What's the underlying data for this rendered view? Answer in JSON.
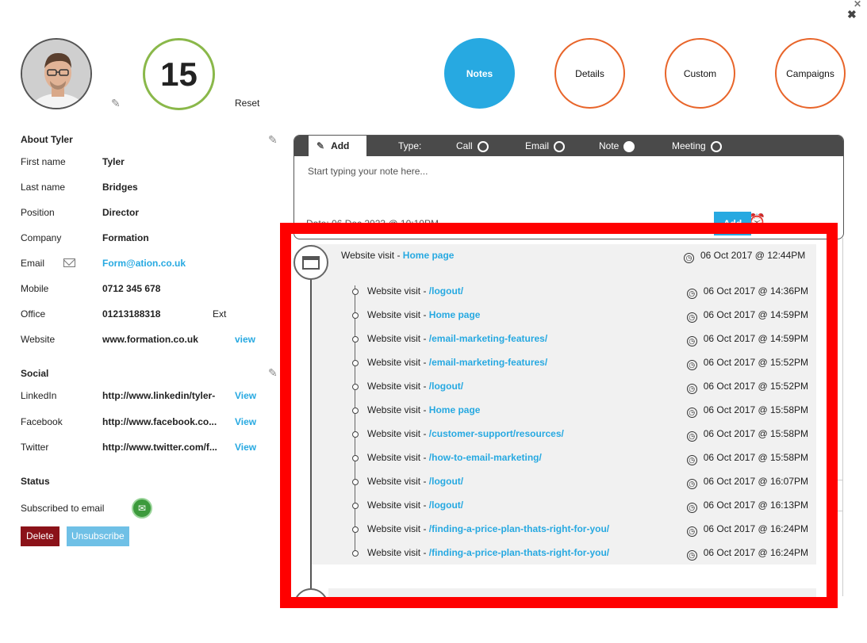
{
  "profile": {
    "score": "15",
    "reset_label": "Reset"
  },
  "tabs": [
    {
      "label": "Notes",
      "active": true
    },
    {
      "label": "Details",
      "active": false
    },
    {
      "label": "Custom",
      "active": false
    },
    {
      "label": "Campaigns",
      "active": false
    }
  ],
  "about": {
    "title": "About Tyler",
    "first_name_label": "First name",
    "first_name": "Tyler",
    "last_name_label": "Last name",
    "last_name": "Bridges",
    "position_label": "Position",
    "position": "Director",
    "company_label": "Company",
    "company": "Formation",
    "email_label": "Email",
    "email": "Form@ation.co.uk",
    "mobile_label": "Mobile",
    "mobile": "0712 345 678",
    "office_label": "Office",
    "office": "01213188318",
    "ext_label": "Ext",
    "website_label": "Website",
    "website": "www.formation.co.uk",
    "website_link": "view"
  },
  "social": {
    "title": "Social",
    "linkedin_label": "LinkedIn",
    "linkedin": "http://www.linkedin/tyler-",
    "linkedin_link": "View",
    "facebook_label": "Facebook",
    "facebook": "http://www.facebook.co...",
    "facebook_link": "View",
    "twitter_label": "Twitter",
    "twitter": "http://www.twitter.com/f...",
    "twitter_link": "View"
  },
  "status": {
    "title": "Status",
    "subscribed_label": "Subscribed to email",
    "delete_label": "Delete",
    "unsubscribe_label": "Unsubscribe"
  },
  "note": {
    "add_tab": "Add",
    "type_label": "Type:",
    "types": [
      "Call",
      "Email",
      "Note",
      "Meeting"
    ],
    "selected_type": "Note",
    "placeholder": "Start typing your note here...",
    "date_text": "Date: 06 Dec 2023 @ 10:10PM",
    "add_button": "Add"
  },
  "timeline": {
    "header_prefix": "Website visit - ",
    "header_page": "Home page",
    "header_time": "06 Oct 2017 @ 12:44PM",
    "visits": [
      {
        "prefix": "Website visit - ",
        "page": "/logout/",
        "time": "06 Oct 2017 @ 14:36PM"
      },
      {
        "prefix": "Website visit - ",
        "page": "Home page",
        "time": "06 Oct 2017 @ 14:59PM"
      },
      {
        "prefix": "Website visit - ",
        "page": "/email-marketing-features/",
        "time": "06 Oct 2017 @ 14:59PM"
      },
      {
        "prefix": "Website visit - ",
        "page": "/email-marketing-features/",
        "time": "06 Oct 2017 @ 15:52PM"
      },
      {
        "prefix": "Website visit - ",
        "page": "/logout/",
        "time": "06 Oct 2017 @ 15:52PM"
      },
      {
        "prefix": "Website visit - ",
        "page": "Home page",
        "time": "06 Oct 2017 @ 15:58PM"
      },
      {
        "prefix": "Website visit - ",
        "page": "/customer-support/resources/",
        "time": "06 Oct 2017 @ 15:58PM"
      },
      {
        "prefix": "Website visit - ",
        "page": "/how-to-email-marketing/",
        "time": "06 Oct 2017 @ 15:58PM"
      },
      {
        "prefix": "Website visit - ",
        "page": "/logout/",
        "time": "06 Oct 2017 @ 16:07PM"
      },
      {
        "prefix": "Website visit - ",
        "page": "/logout/",
        "time": "06 Oct 2017 @ 16:13PM"
      },
      {
        "prefix": "Website visit - ",
        "page": "/finding-a-price-plan-thats-right-for-you/",
        "time": "06 Oct 2017 @ 16:24PM"
      },
      {
        "prefix": "Website visit - ",
        "page": "/finding-a-price-plan-thats-right-for-you/",
        "time": "06 Oct 2017 @ 16:24PM"
      }
    ]
  },
  "icons": {
    "close": "close-icon",
    "pencil": "pencil-icon",
    "mail": "mail-icon",
    "clock": "clock-icon",
    "monitor": "monitor-icon",
    "folder": "folder-icon",
    "alarm": "alarm-icon"
  },
  "colors": {
    "accent": "#27a9e1",
    "tab_border": "#e8652a",
    "score_ring": "#8ab84a",
    "delete": "#8b1219",
    "unsubscribe": "#6fc0e6",
    "highlight_frame": "#ff0000"
  }
}
